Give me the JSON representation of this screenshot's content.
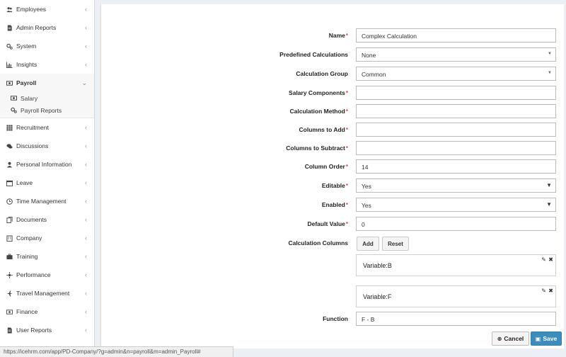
{
  "sidebar": {
    "items": [
      {
        "label": "Employees"
      },
      {
        "label": "Admin Reports"
      },
      {
        "label": "System"
      },
      {
        "label": "Insights"
      },
      {
        "label": "Payroll"
      },
      {
        "label": "Recruitment"
      },
      {
        "label": "Discussions"
      },
      {
        "label": "Personal Information"
      },
      {
        "label": "Leave"
      },
      {
        "label": "Time Management"
      },
      {
        "label": "Documents"
      },
      {
        "label": "Company"
      },
      {
        "label": "Training"
      },
      {
        "label": "Performance"
      },
      {
        "label": "Travel Management"
      },
      {
        "label": "Finance"
      },
      {
        "label": "User Reports"
      }
    ],
    "payroll_sub": [
      {
        "label": "Salary"
      },
      {
        "label": "Payroll Reports"
      }
    ]
  },
  "form": {
    "name": {
      "label": "Name",
      "value": "Complex Calculation"
    },
    "predefined": {
      "label": "Predefined Calculations",
      "value": "None"
    },
    "group": {
      "label": "Calculation Group",
      "value": "Common"
    },
    "salary_components": {
      "label": "Salary Components",
      "value": ""
    },
    "calc_method": {
      "label": "Calculation Method",
      "value": ""
    },
    "cols_add": {
      "label": "Columns to Add",
      "value": ""
    },
    "cols_subtract": {
      "label": "Columns to Subtract",
      "value": ""
    },
    "col_order": {
      "label": "Column Order",
      "value": "14"
    },
    "editable": {
      "label": "Editable",
      "value": "Yes"
    },
    "enabled": {
      "label": "Enabled",
      "value": "Yes"
    },
    "default_value": {
      "label": "Default Value",
      "value": "0"
    },
    "calc_columns": {
      "label": "Calculation Columns",
      "add_label": "Add",
      "reset_label": "Reset"
    },
    "variables": [
      {
        "label": "Variable:B"
      },
      {
        "label": "Variable:F"
      }
    ],
    "function": {
      "label": "Function",
      "value": "F - B"
    },
    "cancel_label": "Cancel",
    "save_label": "Save"
  },
  "status_url": "https://icehrm.com/app/PD-Company/?g=admin&n=payroll&m=admin_Payroll#",
  "colors": {
    "primary": "#3c8dbc",
    "required": "#dd4b39"
  }
}
